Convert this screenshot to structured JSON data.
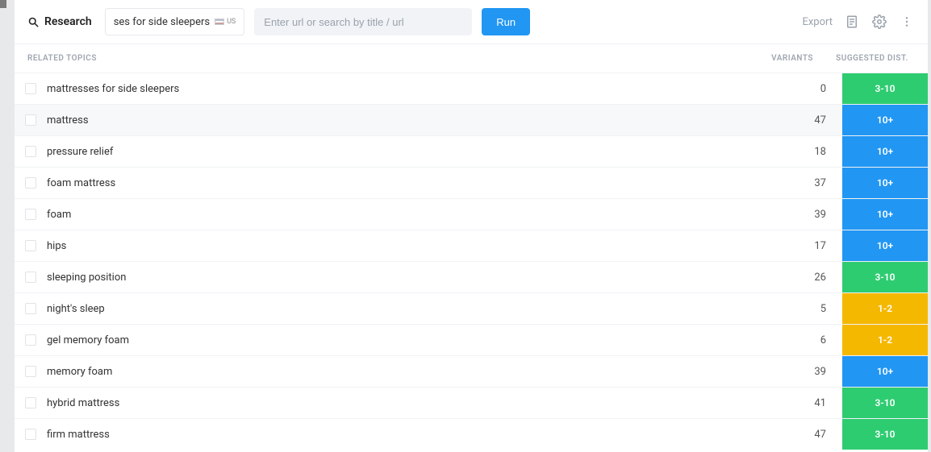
{
  "topbar": {
    "title": "Research",
    "chip_text": "ses for side sleepers",
    "locale": "US",
    "url_placeholder": "Enter url or search by title / url",
    "run_label": "Run",
    "export_label": "Export"
  },
  "columns": {
    "topics": "RELATED TOPICS",
    "variants": "VARIANTS",
    "dist": "SUGGESTED DIST."
  },
  "colors": {
    "green": "#2ecc71",
    "blue": "#2196f3",
    "yellow": "#f5b800"
  },
  "rows": [
    {
      "topic": "mattresses for side sleepers",
      "variants": 0,
      "dist": "3-10",
      "color": "green"
    },
    {
      "topic": "mattress",
      "variants": 47,
      "dist": "10+",
      "color": "blue",
      "hovered": true
    },
    {
      "topic": "pressure relief",
      "variants": 18,
      "dist": "10+",
      "color": "blue"
    },
    {
      "topic": "foam mattress",
      "variants": 37,
      "dist": "10+",
      "color": "blue"
    },
    {
      "topic": "foam",
      "variants": 39,
      "dist": "10+",
      "color": "blue"
    },
    {
      "topic": "hips",
      "variants": 17,
      "dist": "10+",
      "color": "blue"
    },
    {
      "topic": "sleeping position",
      "variants": 26,
      "dist": "3-10",
      "color": "green"
    },
    {
      "topic": "night's sleep",
      "variants": 5,
      "dist": "1-2",
      "color": "yellow"
    },
    {
      "topic": "gel memory foam",
      "variants": 6,
      "dist": "1-2",
      "color": "yellow"
    },
    {
      "topic": "memory foam",
      "variants": 39,
      "dist": "10+",
      "color": "blue"
    },
    {
      "topic": "hybrid mattress",
      "variants": 41,
      "dist": "3-10",
      "color": "green"
    },
    {
      "topic": "firm mattress",
      "variants": 47,
      "dist": "3-10",
      "color": "green"
    }
  ]
}
